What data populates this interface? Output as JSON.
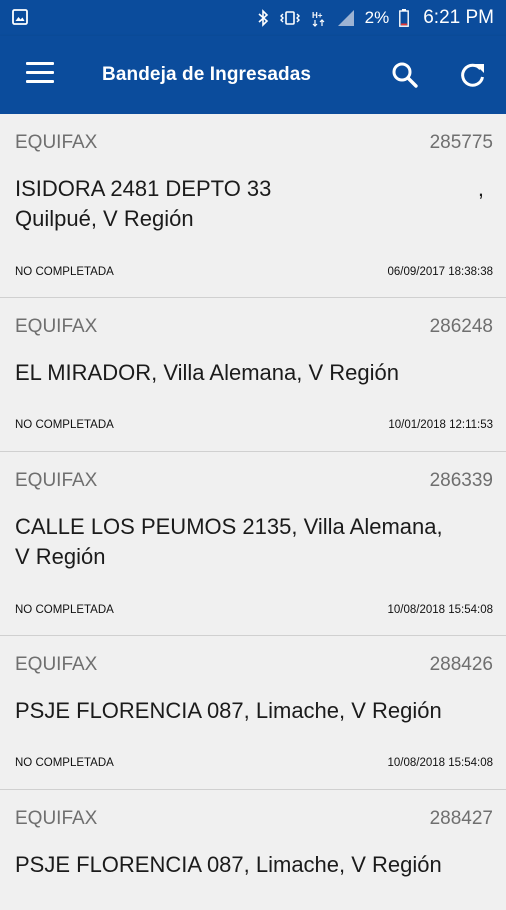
{
  "status_bar": {
    "battery_percent": "2%",
    "time": "6:21 PM",
    "icons": [
      "image-notification-icon",
      "bluetooth-icon",
      "vibrate-icon",
      "hplus-signal-icon",
      "cell-signal-icon",
      "battery-icon"
    ]
  },
  "app_bar": {
    "title": "Bandeja de Ingresadas",
    "icons": [
      "menu-icon",
      "search-icon",
      "refresh-icon"
    ]
  },
  "colors": {
    "primary": "#0b4c9c",
    "background": "#ededed"
  },
  "items": [
    {
      "company": "EQUIFAX",
      "number": "285775",
      "address_line1": "ISIDORA 2481 DEPTO 33",
      "address_line2": "Quilpué, V Región",
      "trailing": ",",
      "status": "NO COMPLETADA",
      "datetime": "06/09/2017 18:38:38"
    },
    {
      "company": "EQUIFAX",
      "number": "286248",
      "address_line1": "EL MIRADOR, Villa Alemana, V Región",
      "address_line2": "",
      "status": "NO COMPLETADA",
      "datetime": "10/01/2018 12:11:53"
    },
    {
      "company": "EQUIFAX",
      "number": "286339",
      "address_line1": "CALLE LOS PEUMOS 2135, Villa Alemana,",
      "address_line2": "V Región",
      "status": "NO COMPLETADA",
      "datetime": "10/08/2018 15:54:08"
    },
    {
      "company": "EQUIFAX",
      "number": "288426",
      "address_line1": "PSJE  FLORENCIA 087, Limache, V Región",
      "address_line2": "",
      "status": "NO COMPLETADA",
      "datetime": "10/08/2018 15:54:08"
    },
    {
      "company": "EQUIFAX",
      "number": "288427",
      "address_line1": "PSJE  FLORENCIA 087, Limache, V Región",
      "address_line2": "",
      "status": "",
      "datetime": ""
    }
  ]
}
